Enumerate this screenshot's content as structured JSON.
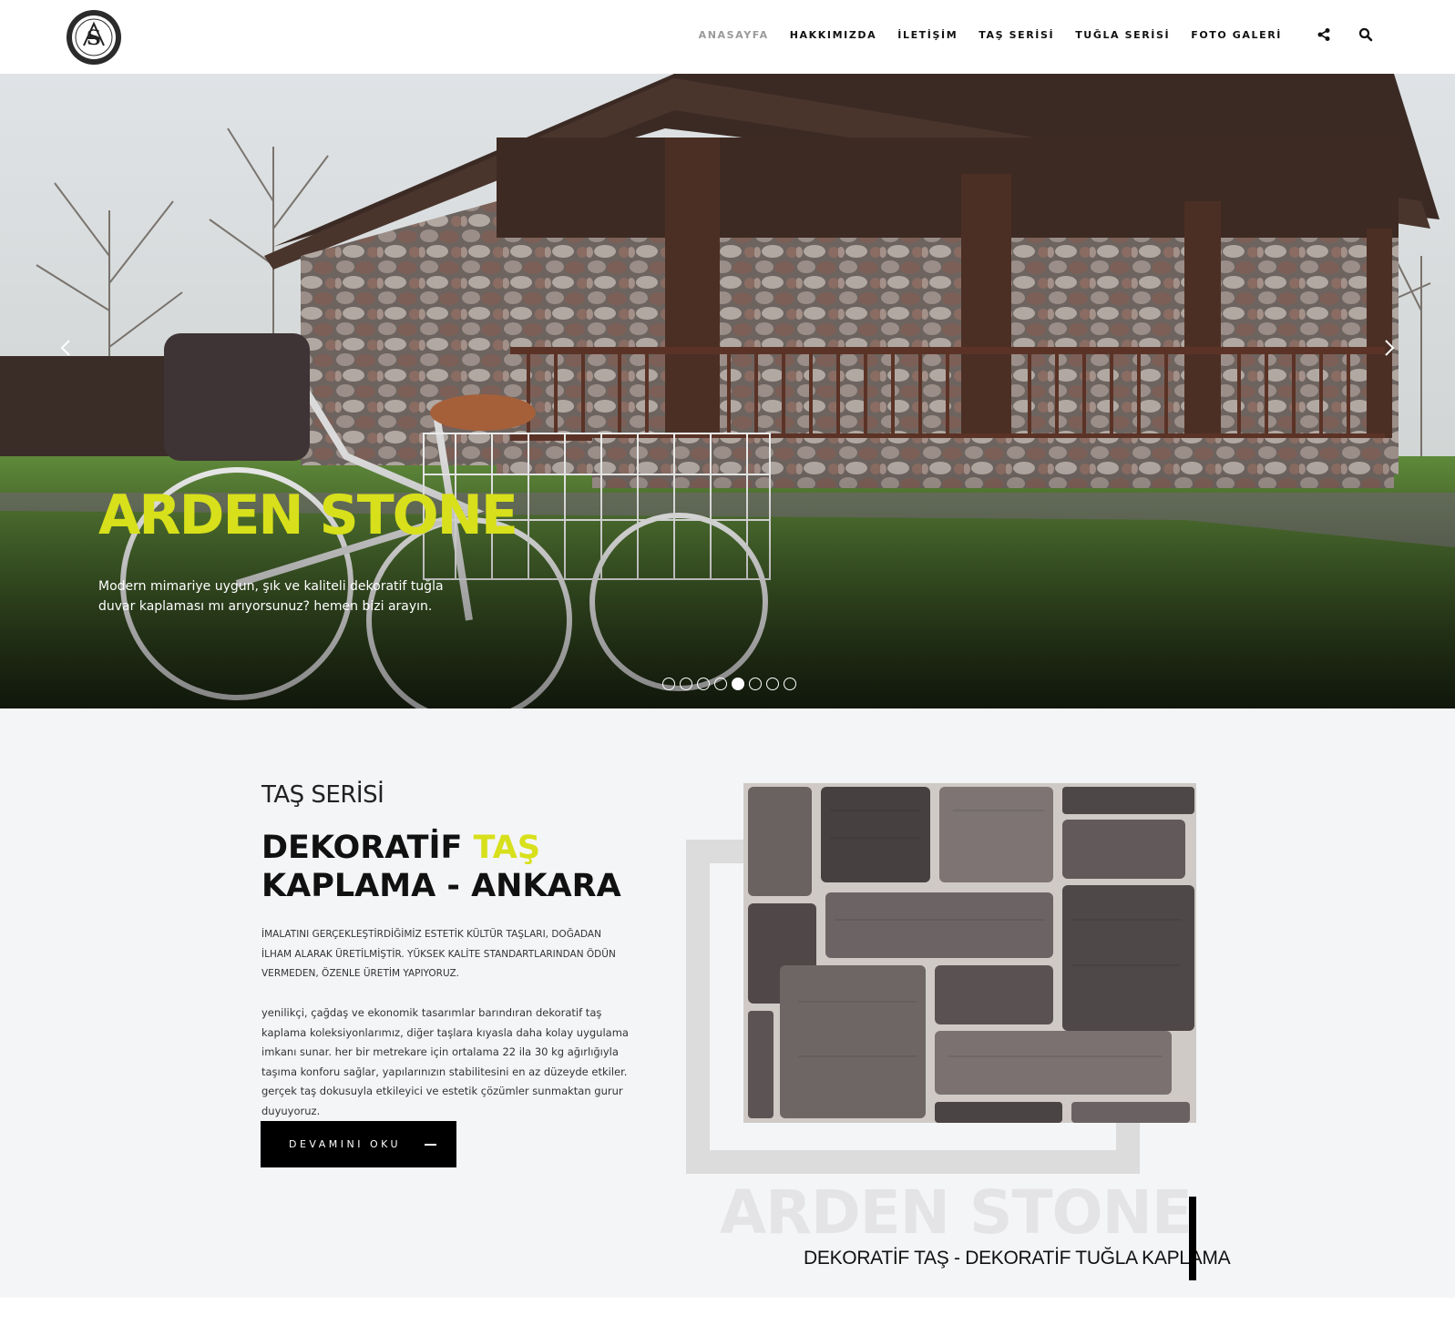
{
  "header": {
    "logo_alt": "ARDEN STONE",
    "nav": [
      {
        "label": "ANASAYFA",
        "active": true
      },
      {
        "label": "HAKKIMIZDA",
        "active": false
      },
      {
        "label": "İLETİŞİM",
        "active": false
      },
      {
        "label": "TAŞ SERİSİ",
        "active": false
      },
      {
        "label": "TUĞLA SERİSİ",
        "active": false
      },
      {
        "label": "FOTO GALERİ",
        "active": false
      }
    ],
    "icons": [
      "share-icon",
      "search-icon"
    ]
  },
  "hero": {
    "title": "ARDEN STONE",
    "text": "Modern mimariye uygun, şık ve kaliteli dekoratif tuğla duvar kaplaması mı arıyorsunuz? hemen bizi arayın.",
    "slide_count": 8,
    "active_slide": 5,
    "title_color": "#d7e01a"
  },
  "section": {
    "kicker": "TAŞ SERİSİ",
    "headline_part1": "DEKORATİF ",
    "headline_accent": "TAŞ",
    "headline_part2": "KAPLAMA - ANKARA",
    "para1": "İMALATINI GERÇEKLEŞTİRDİĞİMİZ ESTETİK KÜLTÜR TAŞLARI, DOĞADAN İLHAM ALARAK ÜRETİLMİŞTİR. YÜKSEK KALİTE STANDARTLARINDAN ÖDÜN VERMEDEN, ÖZENLE ÜRETİM YAPIYORUZ.",
    "para2": "yenilikçi, çağdaş ve ekonomik tasarımlar barındıran dekoratif taş kaplama koleksiyonlarımız, diğer taşlara kıyasla daha kolay uygulama imkanı sunar. her bir metrekare için ortalama 22 ila 30 kg ağırlığıyla taşıma konforu sağlar, yapılarınızın stabilitesini en az düzeyde etkiler. gerçek taş dokusuyla etkileyici ve estetik çözümler sunmaktan gurur duyuyoruz.",
    "cta_label": "DEVAMINI OKU",
    "watermark": "ARDEN STONE",
    "subtitle": "DEKORATİF TAŞ - DEKORATİF TUĞLA KAPLAMA",
    "accent_color": "#d7e01a"
  }
}
